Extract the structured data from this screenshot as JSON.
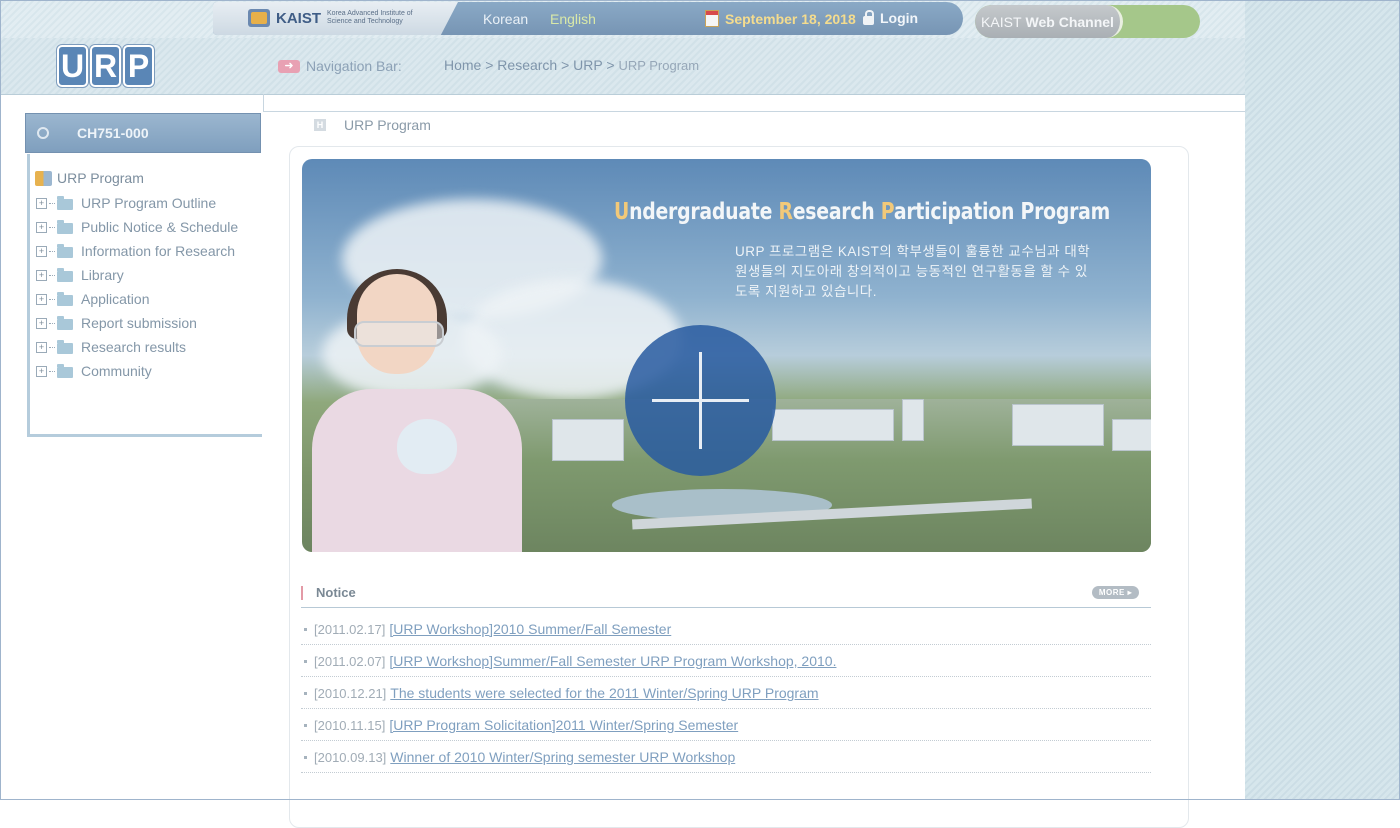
{
  "header": {
    "kaist_word": "KAIST",
    "kaist_subtitle": "Korea Advanced Institute of Science and Technology",
    "lang_korean": "Korean",
    "lang_english": "English",
    "date": "September 18, 2018",
    "login": "Login",
    "web_channel_prefix": "KAIST",
    "web_channel_label": "Web Channel"
  },
  "logo": {
    "letters": [
      "U",
      "R",
      "P"
    ]
  },
  "navigation": {
    "label": "Navigation Bar:",
    "breadcrumb_path": "Home > Research > URP >",
    "breadcrumb_current": "URP Program"
  },
  "sidebar": {
    "code": "CH751-000",
    "root": "URP Program",
    "items": [
      "URP Program Outline",
      "Public Notice & Schedule",
      "Information for Research",
      "Library",
      "Application",
      "Report submission",
      "Research results",
      "Community"
    ]
  },
  "page": {
    "title": "URP Program",
    "h_icon": "H"
  },
  "banner": {
    "title_u": "U",
    "title_ndergraduate": "ndergraduate ",
    "title_r": "R",
    "title_esearch": "esearch ",
    "title_p": "P",
    "title_articipation": "articipation Program",
    "description": "URP 프로그램은 KAIST의 학부생들이 훌륭한 교수님과 대학원생들의 지도아래 창의적이고 능동적인 연구활동을 할 수 있도록 지원하고 있습니다."
  },
  "notice": {
    "title": "Notice",
    "more": "MORE ▸",
    "items": [
      {
        "date": "[2011.02.17]",
        "title": "[URP Workshop]2010 Summer/Fall Semester"
      },
      {
        "date": "[2011.02.07]",
        "title": "[URP Workshop]Summer/Fall Semester URP Program Workshop, 2010."
      },
      {
        "date": "[2010.12.21]",
        "title": "The students were selected for the 2011 Winter/Spring URP Program"
      },
      {
        "date": "[2010.11.15]",
        "title": "[URP Program Solicitation]2011 Winter/Spring Semester"
      },
      {
        "date": "[2010.09.13]",
        "title": "Winner of 2010 Winter/Spring semester URP Workshop"
      }
    ]
  },
  "icons": {
    "calendar": "calendar-icon",
    "lock": "lock-icon",
    "arrow": "arrow-right-icon",
    "folder": "folder-icon",
    "expand": "plus-box-icon",
    "play_overlay": "crosshair-plus-icon"
  },
  "colors": {
    "accent_blue": "#7795b4",
    "date_yellow": "#f4dc8e",
    "english_green": "#d9e9a8",
    "link_blue": "#7f9fbf",
    "overlay_blue": "#285aa0"
  }
}
